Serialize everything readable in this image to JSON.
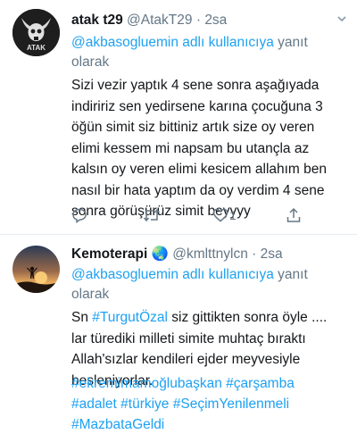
{
  "tweets": [
    {
      "name": "atak t29",
      "handle": "@AtakT29",
      "separator": "·",
      "time": "2sa",
      "reply_prefix": "",
      "reply_mention": "@akbasogluemin adlı kullanıcıya",
      "reply_suffix": " yanıt olarak",
      "body": "Sizi vezir yaptık 4 sene sonra aşağıyada indiririz sen yedirsene karına çocuğuna 3 öğün simit siz bittiniz artık size oy veren elimi kessem mi napsam bu utançla az kalsın oy veren elimi kesicem allahım ben nasıl bir hata yaptım da oy verdim 4 sene sonra görüşürüz simit beyyyy",
      "like_count": "1",
      "avatar_icon": "horned-skull-logo",
      "avatar_text": "ATAK"
    },
    {
      "name": "Kemoterapi",
      "name_emoji": "🌏",
      "handle": "@kmlttnylcn",
      "separator": "·",
      "time": "2sa",
      "reply_mention": "@akbasogluemin adlı kullanıcıya",
      "reply_suffix": " yanıt olarak",
      "body_1": "Sn ",
      "body_hash_1": "#TurgutÖzal",
      "body_2": " siz gittikten sonra öyle .... lar türediki milleti simite muhtaç bıraktı Allah'sızlar kendileri ejder meyvesiyle besleniyorlar.",
      "hashtags_line_1": "#ekremimamoğlubaşkan #çarşamba",
      "hashtags_line_2": "#adalet #türkiye #SeçimYenilenmeli",
      "hashtags_line_3": "#MazbataGeldi",
      "avatar_icon": "sunset-silhouette-photo"
    }
  ],
  "colors": {
    "link": "#1da1f2",
    "muted": "#657786",
    "text": "#14171a",
    "divider": "#e6ecf0"
  }
}
